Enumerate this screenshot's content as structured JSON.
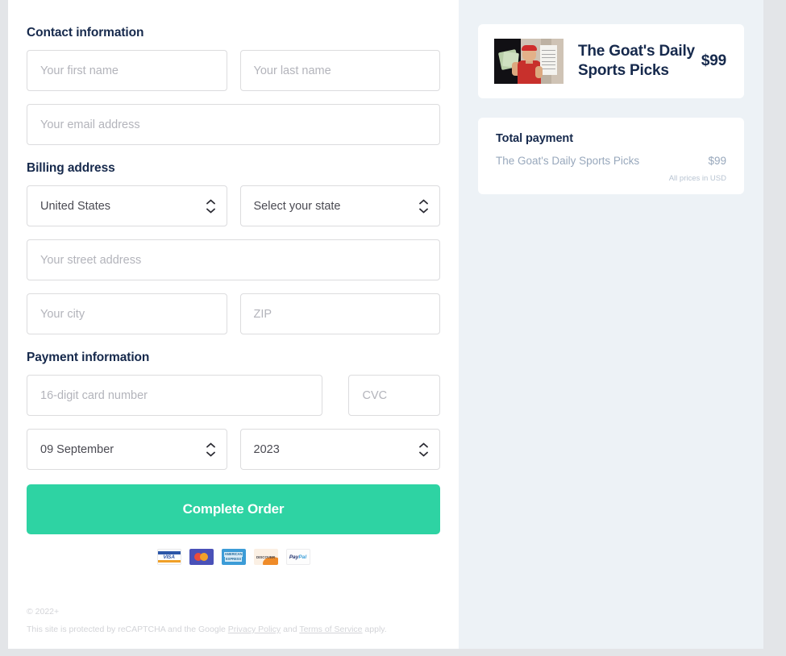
{
  "form": {
    "contact": {
      "heading": "Contact information",
      "first_name_placeholder": "Your first name",
      "last_name_placeholder": "Your last name",
      "email_placeholder": "Your email address"
    },
    "billing": {
      "heading": "Billing address",
      "country_value": "United States",
      "state_value": "Select your state",
      "street_placeholder": "Your street address",
      "city_placeholder": "Your city",
      "zip_placeholder": "ZIP"
    },
    "payment": {
      "heading": "Payment information",
      "card_number_placeholder": "16-digit card number",
      "cvc_placeholder": "CVC",
      "expiry_month_value": "09 September",
      "expiry_year_value": "2023"
    },
    "submit_label": "Complete Order",
    "accepted_cards": [
      {
        "name": "visa",
        "label": "VISA"
      },
      {
        "name": "mastercard",
        "label": ""
      },
      {
        "name": "amex",
        "label_line1": "AMERICAN",
        "label_line2": "EXPRESS"
      },
      {
        "name": "discover",
        "label": "DISCOVER"
      },
      {
        "name": "paypal",
        "label_a": "Pay",
        "label_b": "Pal"
      }
    ]
  },
  "footer": {
    "copyright": "© 2022+",
    "recaptcha_prefix": "This site is protected by reCAPTCHA and the Google ",
    "privacy_link": "Privacy Policy",
    "recaptcha_middle": " and ",
    "terms_link": "Terms of Service",
    "recaptcha_suffix": " apply."
  },
  "summary": {
    "product": {
      "title": "The Goat's Daily Sports Picks",
      "price": "$99"
    },
    "total": {
      "heading": "Total payment",
      "line_item_label": "The Goat's Daily Sports Picks",
      "line_item_price": "$99",
      "currency_note": "All prices in USD"
    }
  },
  "colors": {
    "accent_green": "#2ed3a3",
    "heading_navy": "#16294c",
    "panel_bg": "#edf2f6",
    "muted_text": "#98a8bc"
  }
}
